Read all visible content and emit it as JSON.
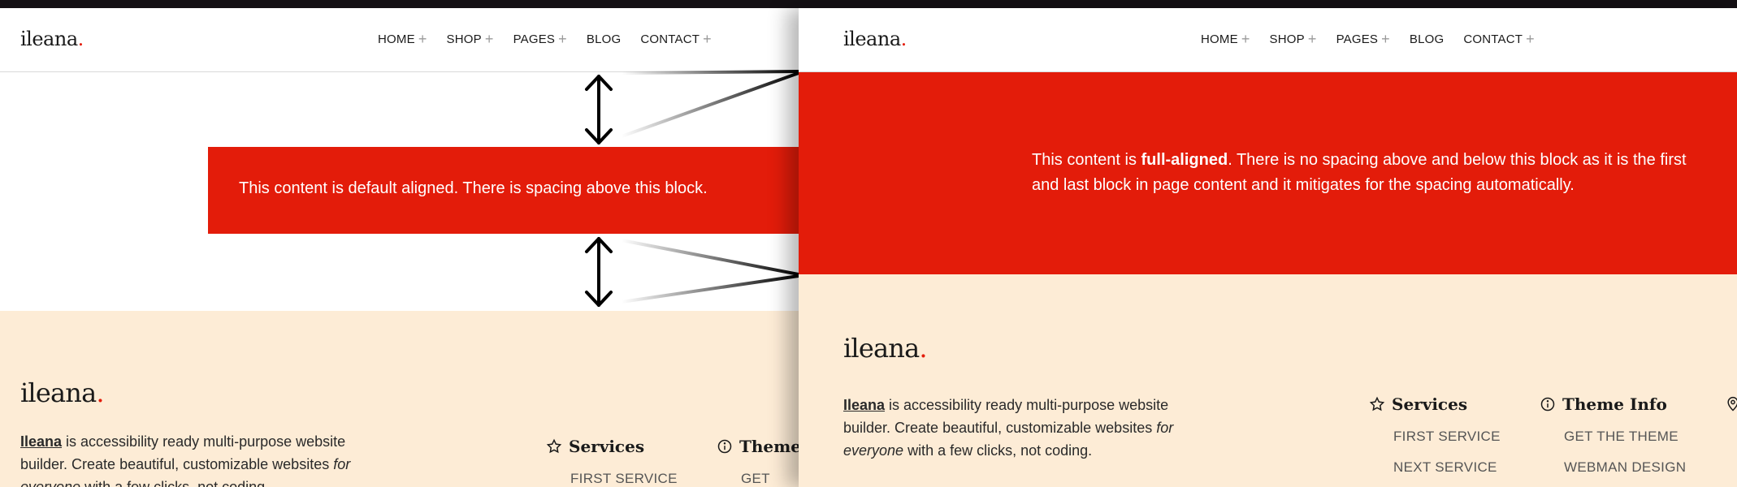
{
  "brand": {
    "logo_text": "ileana",
    "logo_dot": ".",
    "accent_color": "#e31c0a",
    "footer_bg": "#fdecd6"
  },
  "nav": [
    {
      "label": "HOME",
      "has_submenu": true
    },
    {
      "label": "SHOP",
      "has_submenu": true
    },
    {
      "label": "PAGES",
      "has_submenu": true
    },
    {
      "label": "BLOG",
      "has_submenu": false
    },
    {
      "label": "CONTACT",
      "has_submenu": true
    }
  ],
  "nav_plus": "+",
  "left_panel": {
    "block_text": "This content is default aligned. There is spacing above this block."
  },
  "right_panel": {
    "block_text_before": "This content is ",
    "block_text_bold": "full-aligned",
    "block_text_after": ". There is no spacing above and below this block as it is the first and last block in page content and it mitigates for the spacing automatically."
  },
  "footer": {
    "desc_brand": "Ileana",
    "desc_part1": " is accessibility ready multi-purpose website builder. Create beautiful, customizable websites ",
    "desc_italic_for": "for",
    "desc_italic_everyone": "everyone",
    "desc_part2": " with a few clicks, not coding.",
    "services_heading": "Services",
    "services_icon": "star-icon",
    "services_links": [
      "FIRST SERVICE",
      "NEXT SERVICE"
    ],
    "theme_heading": "Theme Info",
    "theme_icon": "info-icon",
    "theme_links": [
      "GET THE THEME",
      "WEBMAN DESIGN"
    ],
    "left_theme_heading": "Theme",
    "left_theme_link": "GET THE",
    "location_icon": "map-pin-icon"
  }
}
